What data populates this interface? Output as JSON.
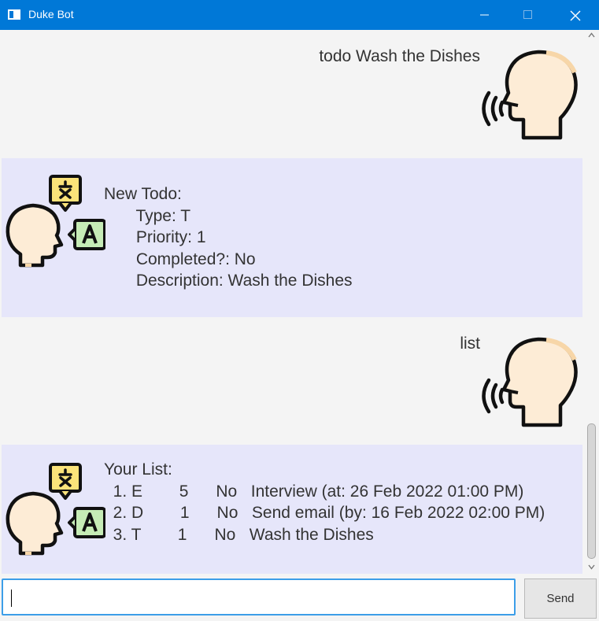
{
  "window": {
    "title": "Duke Bot"
  },
  "messages": [
    {
      "from": "user",
      "text": "todo Wash the Dishes"
    },
    {
      "from": "bot",
      "text": "New Todo:\n       Type: T\n       Priority: 1\n       Completed?: No\n       Description: Wash the Dishes"
    },
    {
      "from": "user",
      "text": "list"
    },
    {
      "from": "bot",
      "text": "Your List:\n  1. E        5      No   Interview (at: 26 Feb 2022 01:00 PM)\n  2. D        1      No   Send email (by: 16 Feb 2022 02:00 PM)\n  3. T        1      No   Wash the Dishes"
    }
  ],
  "input": {
    "value": "",
    "placeholder": ""
  },
  "send_label": "Send",
  "icons": {
    "user": "speaking-head-icon",
    "bot": "translator-head-icon"
  },
  "colors": {
    "titlebar": "#0078d7",
    "bot_bubble": "#e6e6fa",
    "background": "#f4f4f4",
    "input_focus": "#3c9ee8"
  }
}
